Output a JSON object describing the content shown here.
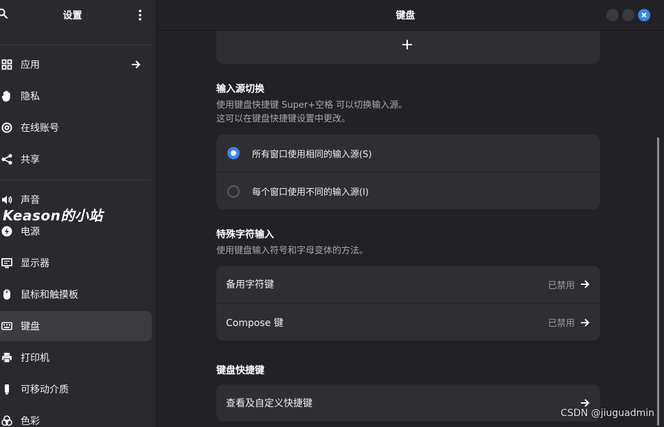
{
  "sidebar": {
    "title": "设置",
    "items": [
      {
        "label": "应用",
        "icon": "apps-grid-icon"
      },
      {
        "label": "隐私",
        "icon": "hand-icon"
      },
      {
        "label": "在线账号",
        "icon": "at-sign-icon"
      },
      {
        "label": "共享",
        "icon": "share-icon"
      },
      {
        "label": "声音",
        "icon": "speaker-icon"
      },
      {
        "label": "电源",
        "icon": "power-bolt-icon"
      },
      {
        "label": "显示器",
        "icon": "display-icon"
      },
      {
        "label": "鼠标和触摸板",
        "icon": "mouse-icon"
      },
      {
        "label": "键盘",
        "icon": "keyboard-icon"
      },
      {
        "label": "打印机",
        "icon": "printer-icon"
      },
      {
        "label": "可移动介质",
        "icon": "removable-media-icon"
      },
      {
        "label": "色彩",
        "icon": "color-icon"
      }
    ],
    "active_index": 8,
    "overlay_text": "Keason的小站"
  },
  "header": {
    "title": "键盘"
  },
  "input_switch": {
    "title": "输入源切换",
    "desc_line1": "使用键盘快捷键 Super+空格 可以切换输入源。",
    "desc_line2": "这可以在键盘快捷键设置中更改。",
    "options": [
      {
        "label": "所有窗口使用相同的输入源(S)",
        "selected": true
      },
      {
        "label": "每个窗口使用不同的输入源(I)",
        "selected": false
      }
    ]
  },
  "special_chars": {
    "title": "特殊字符输入",
    "desc": "使用键盘输入符号和字母变体的方法。",
    "rows": [
      {
        "label": "备用字符键",
        "value": "已禁用"
      },
      {
        "label": "Compose 键",
        "value": "已禁用"
      }
    ]
  },
  "shortcuts": {
    "title": "键盘快捷键",
    "row_label": "查看及自定义快捷键"
  },
  "watermark": "CSDN @jiuguadmin",
  "colors": {
    "accent": "#3a84e4",
    "sidebar_bg": "#2a2a2e",
    "main_bg": "#222226",
    "card_bg": "#2e2e33"
  }
}
